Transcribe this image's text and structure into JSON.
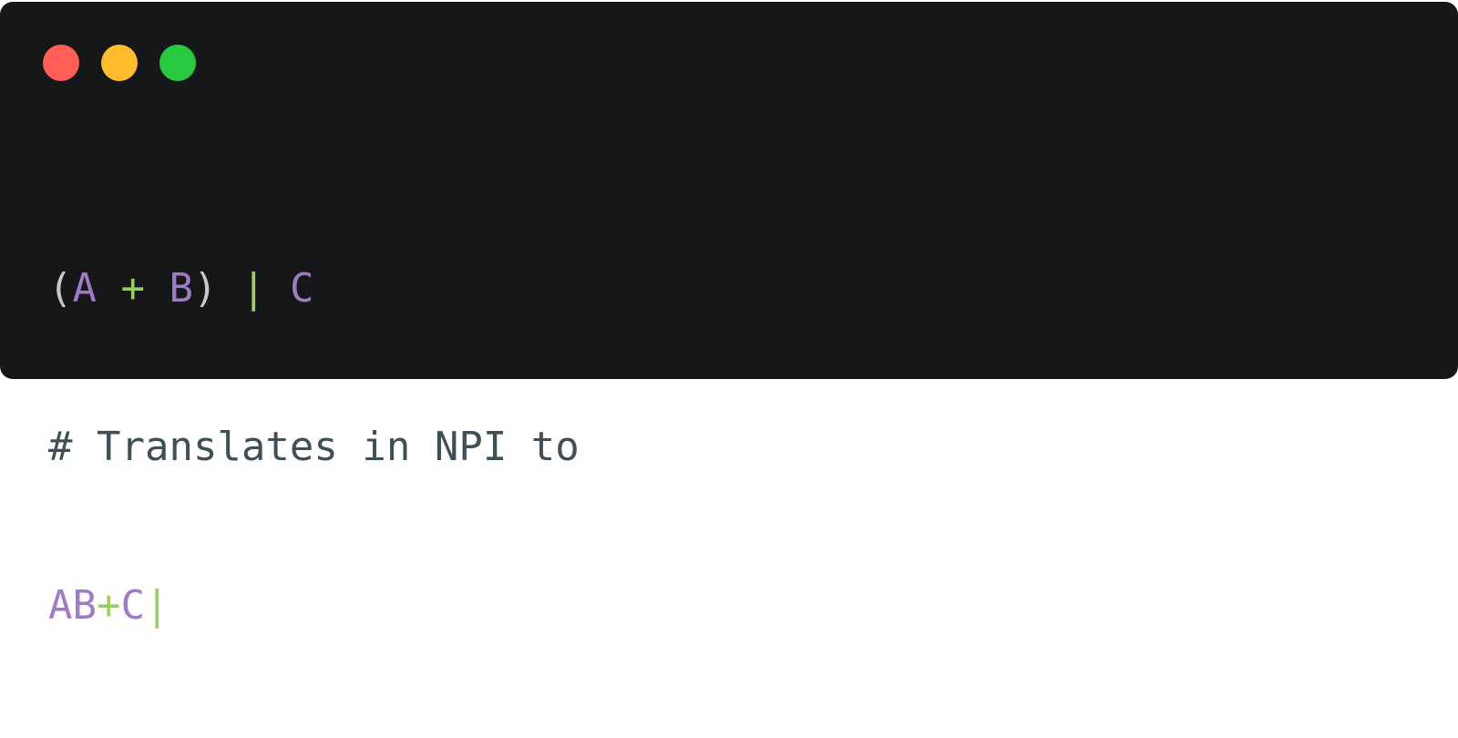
{
  "window": {
    "controls": [
      "close",
      "minimize",
      "maximize"
    ],
    "colors": {
      "background": "#161719",
      "close": "#ff5f57",
      "minimize": "#febc2e",
      "maximize": "#28c840"
    }
  },
  "code": {
    "line1": {
      "open_paren": "(",
      "a": "A",
      "plus": "+",
      "b": "B",
      "close_paren": ")",
      "pipe": "|",
      "c": "C"
    },
    "line2": {
      "comment": "# Translates in NPI to"
    },
    "line3": {
      "ab": "AB",
      "plus": "+",
      "c": "C",
      "pipe": "|"
    },
    "colors": {
      "identifier": "#9f7bc3",
      "operator": "#9ccc65",
      "comment": "#3e4f56",
      "paren": "#c8c8c8"
    }
  }
}
